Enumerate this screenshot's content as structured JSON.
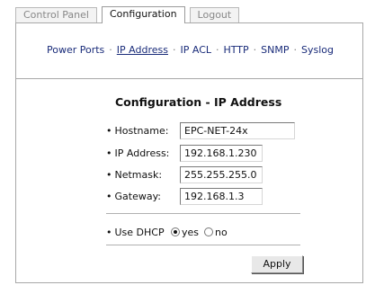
{
  "tabs": [
    "Control Panel",
    "Configuration",
    "Logout"
  ],
  "subnav": {
    "items": [
      "Power Ports",
      "IP Address",
      "IP ACL",
      "HTTP",
      "SNMP",
      "Syslog"
    ],
    "separator": "·"
  },
  "form": {
    "title": "Configuration - IP Address",
    "bullet": "•",
    "hostname": {
      "label": "Hostname:",
      "value": "EPC-NET-24x"
    },
    "ip_address": {
      "label": "IP Address:",
      "value": "192.168.1.230"
    },
    "netmask": {
      "label": "Netmask:",
      "value": "255.255.255.0"
    },
    "gateway": {
      "label": "Gateway:",
      "value": "192.168.1.3"
    },
    "dhcp": {
      "label": "Use DHCP",
      "yes": "yes",
      "no": "no",
      "selected": "yes"
    },
    "apply_label": "Apply"
  }
}
